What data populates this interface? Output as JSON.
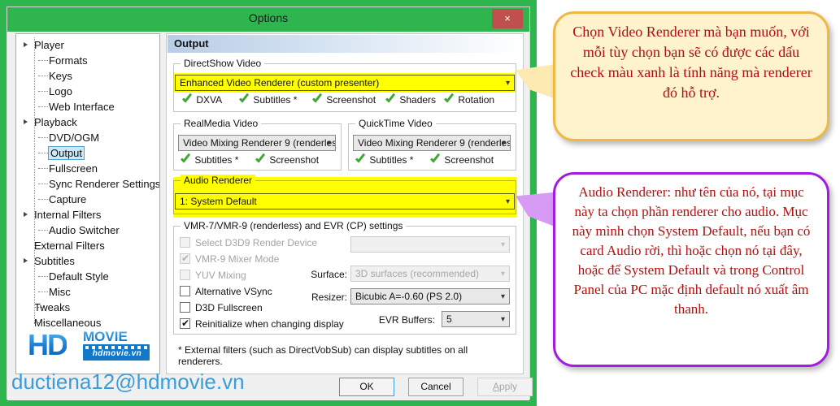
{
  "window": {
    "title": "Options",
    "close_label": "×"
  },
  "sidebar": {
    "items": [
      {
        "label": "Player",
        "level": 0,
        "expandable": true
      },
      {
        "label": "Formats",
        "level": 1
      },
      {
        "label": "Keys",
        "level": 1
      },
      {
        "label": "Logo",
        "level": 1
      },
      {
        "label": "Web Interface",
        "level": 1
      },
      {
        "label": "Playback",
        "level": 0,
        "expandable": true
      },
      {
        "label": "DVD/OGM",
        "level": 1
      },
      {
        "label": "Output",
        "level": 1,
        "selected": true
      },
      {
        "label": "Fullscreen",
        "level": 1
      },
      {
        "label": "Sync Renderer Settings",
        "level": 1
      },
      {
        "label": "Capture",
        "level": 1
      },
      {
        "label": "Internal Filters",
        "level": 0,
        "expandable": true
      },
      {
        "label": "Audio Switcher",
        "level": 1
      },
      {
        "label": "External Filters",
        "level": 0
      },
      {
        "label": "Subtitles",
        "level": 0,
        "expandable": true
      },
      {
        "label": "Default Style",
        "level": 1
      },
      {
        "label": "Misc",
        "level": 1
      },
      {
        "label": "Tweaks",
        "level": 0
      },
      {
        "label": "Miscellaneous",
        "level": 0
      }
    ],
    "logo": {
      "hd": "HD",
      "movie": "MOVIE",
      "domain": "hdmovie.vn"
    }
  },
  "pane": {
    "title": "Output",
    "directshow": {
      "caption": "DirectShow Video",
      "renderer_value": "Enhanced Video Renderer (custom presenter)",
      "features": [
        "DXVA",
        "Subtitles *",
        "Screenshot",
        "Shaders",
        "Rotation"
      ]
    },
    "realmedia": {
      "caption": "RealMedia Video",
      "renderer_value": "Video Mixing Renderer 9 (renderless",
      "features": [
        "Subtitles *",
        "Screenshot"
      ]
    },
    "quicktime": {
      "caption": "QuickTime Video",
      "renderer_value": "Video Mixing Renderer 9 (renderless",
      "features": [
        "Subtitles *",
        "Screenshot"
      ]
    },
    "audio": {
      "caption": "Audio Renderer",
      "renderer_value": "1: System Default"
    },
    "vmr": {
      "caption": "VMR-7/VMR-9 (renderless) and EVR (CP) settings",
      "checkboxes": [
        {
          "label": "Select D3D9 Render Device",
          "checked": false,
          "enabled": false
        },
        {
          "label": "VMR-9 Mixer Mode",
          "checked": true,
          "enabled": false
        },
        {
          "label": "YUV Mixing",
          "checked": false,
          "enabled": false
        },
        {
          "label": "Alternative VSync",
          "checked": false,
          "enabled": true
        },
        {
          "label": "D3D Fullscreen",
          "checked": false,
          "enabled": true
        },
        {
          "label": "Reinitialize when changing display",
          "checked": true,
          "enabled": true
        }
      ],
      "device_value": "",
      "surface_label": "Surface:",
      "surface_value": "3D surfaces (recommended)",
      "resizer_label": "Resizer:",
      "resizer_value": "Bicubic A=-0.60 (PS 2.0)",
      "evr_label": "EVR Buffers:",
      "evr_value": "5"
    },
    "footnote": "* External filters (such as DirectVobSub) can display subtitles on all renderers."
  },
  "buttons": {
    "ok": "OK",
    "cancel": "Cancel",
    "apply_prefix": "A",
    "apply_rest": "pply"
  },
  "watermark": "ductiena12@hdmovie.vn",
  "callouts": {
    "video": "Chọn Video Renderer mà bạn muốn, với mỗi tùy chọn bạn sẽ có được các dấu check màu xanh là tính năng mà renderer đó hỗ trợ.",
    "audio": " Audio Renderer: như tên của nó, tại mục này ta chọn phần renderer cho audio. Mục này mình chọn System Default, nếu bạn có card Audio rời, thì hoặc chọn nó tại đây, hoặc để System Default và trong Control Panel của PC mặc định default nó xuất âm thanh."
  },
  "colors": {
    "frame_green": "#2eb54e",
    "highlight_yellow": "#ffff00",
    "callout_red": "#b01010",
    "purple": "#a31ae0",
    "close_red": "#c0504d"
  }
}
